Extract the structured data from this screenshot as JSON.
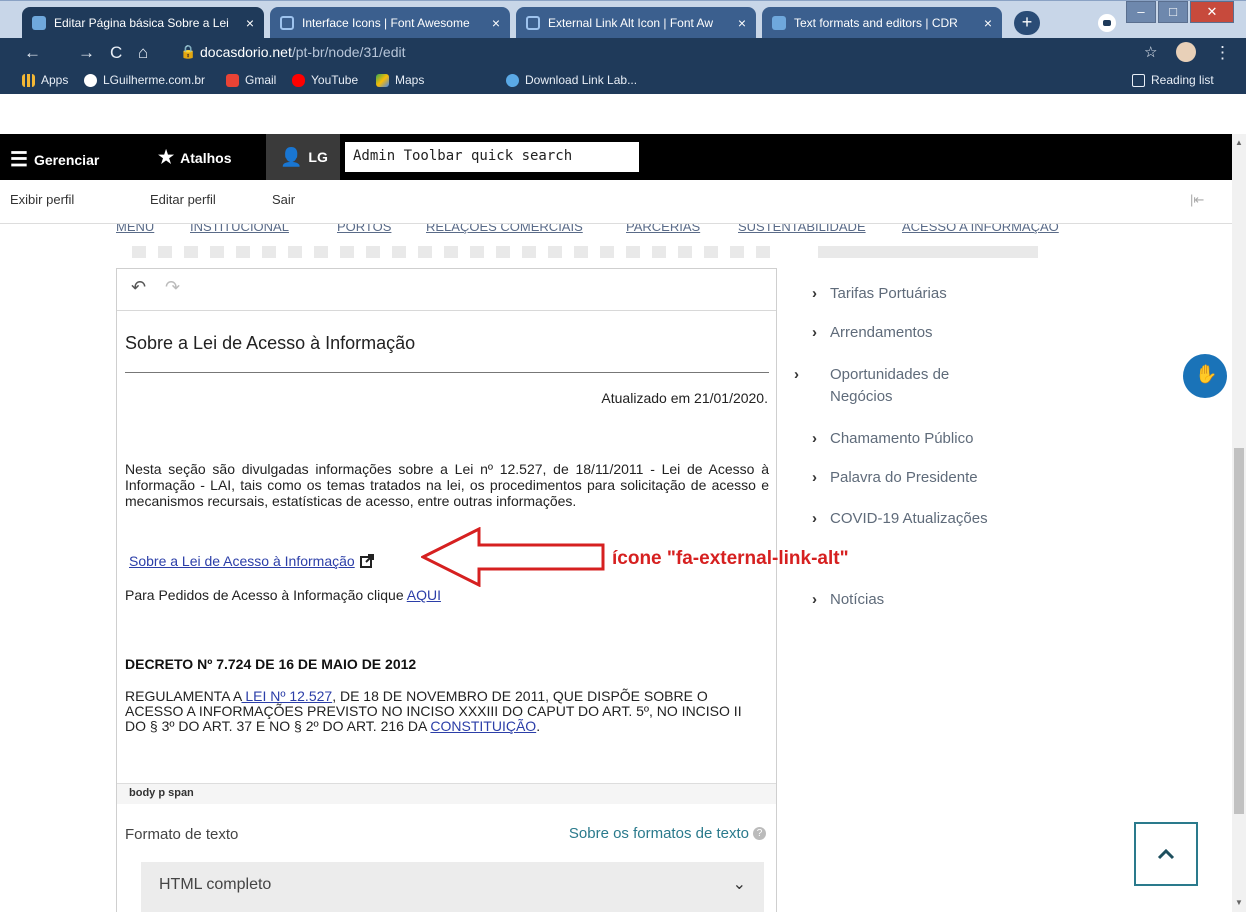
{
  "browser": {
    "tabs": [
      {
        "label": "Editar Página básica Sobre a Lei",
        "active": true,
        "icon": "site-favicon"
      },
      {
        "label": "Interface Icons | Font Awesome",
        "active": false,
        "icon": "flag-icon"
      },
      {
        "label": "External Link Alt Icon | Font Aw",
        "active": false,
        "icon": "flag-icon"
      },
      {
        "label": "Text formats and editors | CDR",
        "active": false,
        "icon": "site-favicon"
      }
    ],
    "tab_close": "×",
    "newtab_label": "+",
    "url_host": "docasdorio.net",
    "url_path": "/pt-br/node/31/edit",
    "bookmarks": [
      {
        "label": "Apps",
        "icon": "apps-grid-icon"
      },
      {
        "label": "LGuilherme.com.br",
        "icon": "globe-icon"
      },
      {
        "label": "Gmail",
        "icon": "gmail-icon"
      },
      {
        "label": "YouTube",
        "icon": "youtube-icon"
      },
      {
        "label": "Maps",
        "icon": "maps-icon"
      },
      {
        "label": "Download Link Lab...",
        "icon": "download-icon"
      }
    ],
    "reading_list": "Reading list"
  },
  "admin_toolbar": {
    "manage": "Gerenciar",
    "shortcuts": "Atalhos",
    "user": "LG",
    "search_placeholder": "Admin Toolbar quick search"
  },
  "user_tray": {
    "view_profile": "Exibir perfil",
    "edit_profile": "Editar perfil",
    "logout": "Sair"
  },
  "site_menu": [
    "MENU",
    "INSTITUCIONAL",
    "PORTOS",
    "RELAÇÕES COMERCIAIS",
    "PARCERIAS",
    "SUSTENTABILIDADE",
    "ACESSO A INFORMAÇÃO"
  ],
  "editor": {
    "heading": "Sobre a Lei de Acesso à Informação",
    "updated": "Atualizado em 21/01/2020.",
    "paragraph": "Nesta seção são divulgadas informações sobre a Lei nº 12.527, de 18/11/2011 - Lei de Acesso à Informação - LAI, tais como os temas tratados na lei, os procedimentos para solicitação de acesso e mecanismos recursais, estatísticas de acesso, entre outras informações.",
    "link1": "Sobre a Lei de Acesso à Informação",
    "pedidos_prefix": "Para Pedidos de Acesso à Informação clique ",
    "pedidos_link": "AQUI",
    "decreto": "DECRETO Nº 7.724 DE 16 DE MAIO DE 2012",
    "regul_prefix": "REGULAMENTA A",
    "regul_link1": " LEI Nº 12.527",
    "regul_mid": ", DE 18 DE NOVEMBRO DE 2011, QUE DISPÕE SOBRE O ACESSO A INFORMAÇÕES PREVISTO NO INCISO XXXIII DO CAPUT DO ART. 5º, NO INCISO II DO § 3º DO ART. 37 E NO § 2º DO ART. 216 DA ",
    "regul_link2": "CONSTITUIÇÃO",
    "regul_suffix": ".",
    "elementspath": "body  p  span"
  },
  "text_format": {
    "label": "Formato de texto",
    "about_link": "Sobre os formatos de texto",
    "selected": "HTML completo"
  },
  "sidebar": [
    "Tarifas Portuárias",
    "Arrendamentos",
    "Oportunidades de Negócios",
    "Chamamento Público",
    "Palavra do Presidente",
    "COVID-19 Atualizações",
    "Notícias"
  ],
  "annotation": "ícone \"fa-external-link-alt\""
}
